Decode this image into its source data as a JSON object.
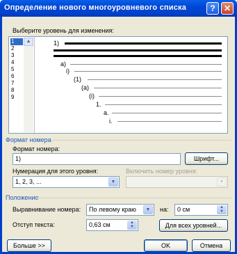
{
  "window": {
    "title": "Определение нового многоуровневого списка",
    "help_glyph": "?",
    "close_glyph": "✕"
  },
  "levels_label": "Выберите уровень для изменения:",
  "levels": [
    "1",
    "2",
    "3",
    "4",
    "5",
    "6",
    "7",
    "8",
    "9"
  ],
  "selected_level": "1",
  "preview_markers": [
    "1)",
    "а)",
    "i)",
    "(1)",
    "(a)",
    "(i)",
    "1.",
    "a.",
    "i."
  ],
  "number_format": {
    "group_title": "Формат номера",
    "format_label": "Формат номера:",
    "format_value": "1)",
    "font_button": "Шрифт...",
    "numbering_label": "Нумерация для этого уровня:",
    "numbering_value": "1, 2, 3, ...",
    "include_label": "Включить номер уровня:",
    "include_value": ""
  },
  "position": {
    "group_title": "Положение",
    "align_label": "Выравнивание номера:",
    "align_value": "По левому краю",
    "at_label": "на:",
    "at_value": "0 см",
    "indent_label": "Отступ текста:",
    "indent_value": "0,63 см",
    "all_levels_button": "Для всех уровней..."
  },
  "footer": {
    "more_button": "Больше >>",
    "ok_button": "OK",
    "cancel_button": "Отмена"
  },
  "colors": {
    "titlebar": "#0046d5",
    "group_title": "#1e56b8",
    "selection": "#316ac5",
    "dialog_bg": "#ece9d8"
  }
}
